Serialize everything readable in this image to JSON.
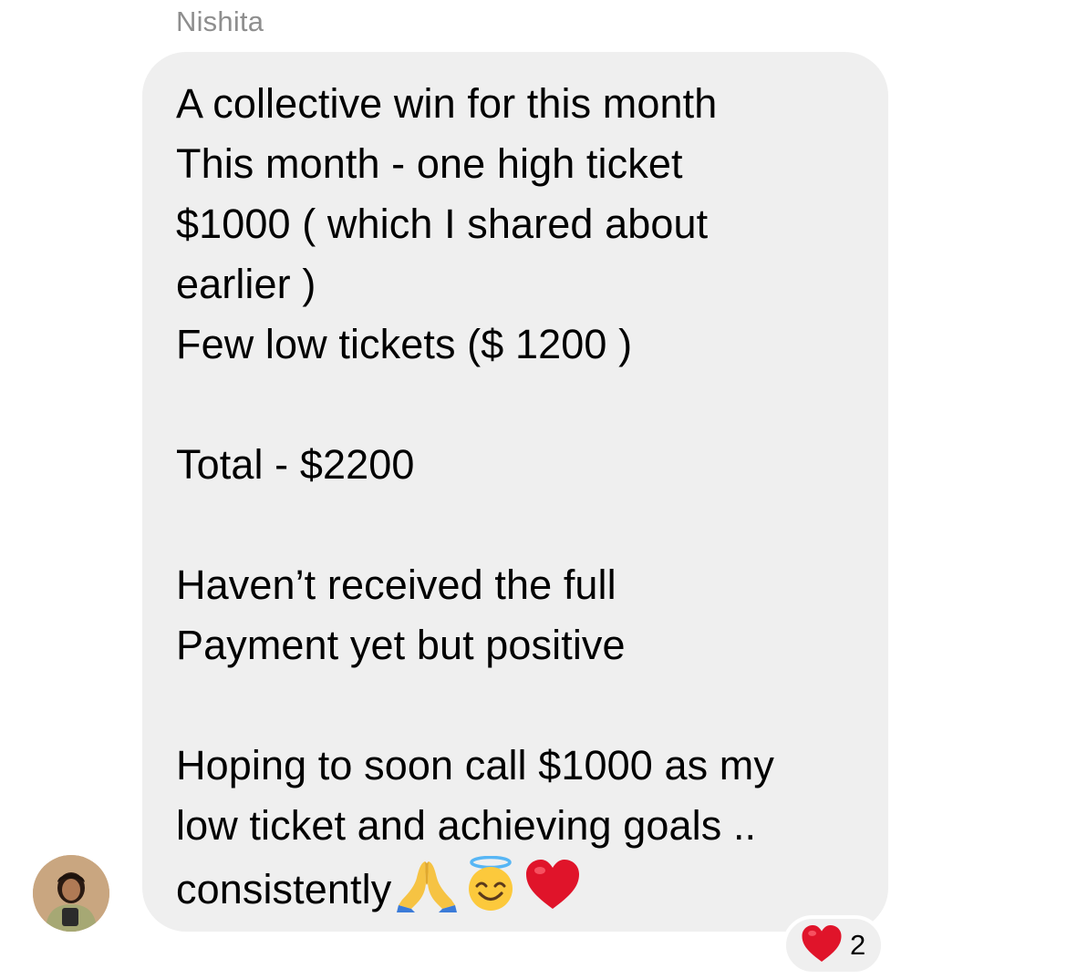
{
  "message": {
    "sender_name": "Nishita",
    "lines": [
      "A collective win for this month",
      "This month - one high ticket",
      "$1000 ( which I shared about",
      "earlier )",
      "Few low tickets ($ 1200 )",
      "",
      "Total - $2200",
      "",
      "Haven’t received the full",
      "Payment yet but positive",
      "",
      "Hoping to soon call $1000 as my",
      "low ticket and achieving goals ..",
      "consistently"
    ],
    "emojis": [
      "praying-hands-icon",
      "smiling-face-with-halo-icon",
      "red-heart-icon"
    ]
  },
  "reaction": {
    "emoji": "red-heart-icon",
    "count": "2"
  },
  "colors": {
    "bubble": "#efefef",
    "sender_name": "#8e8e8e",
    "heart": "#e0142a"
  }
}
